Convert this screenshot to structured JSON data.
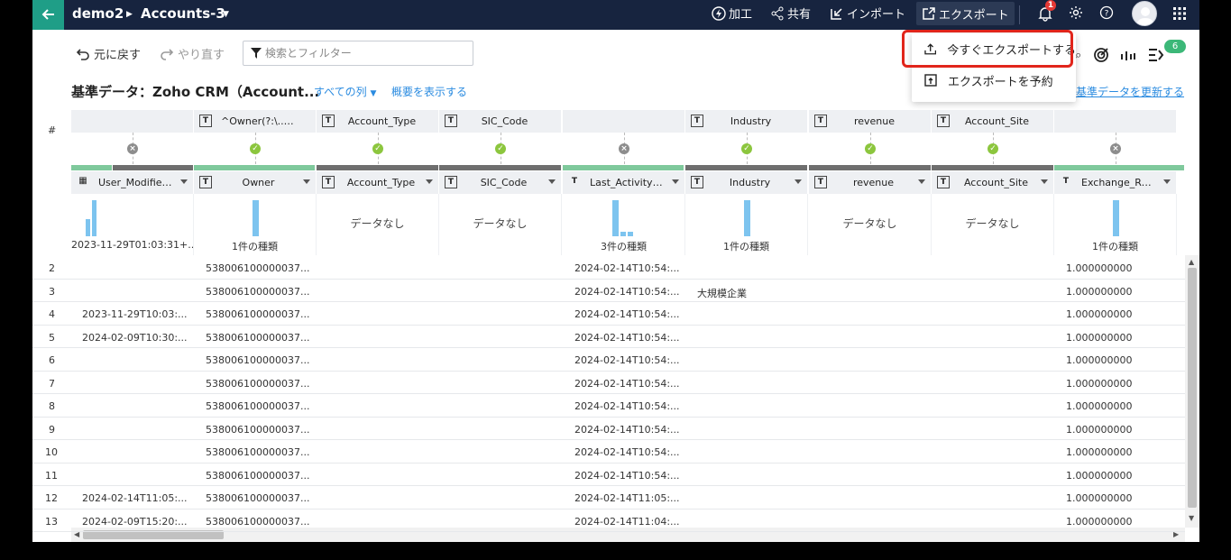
{
  "app": {
    "workspace": "demo2",
    "dataset": "Accounts-3"
  },
  "nav": {
    "process": "加工",
    "share": "共有",
    "import": "インポート",
    "export": "エクスポート",
    "notification_count": "1"
  },
  "toolbar": {
    "undo": "元に戻す",
    "redo": "やり直す",
    "search_placeholder": "検索とフィルター",
    "rules_count": "6"
  },
  "title_row": {
    "title": "基準データ：Zoho CRM（Account...",
    "all_columns": "すべての列",
    "show_summary": "概要を表示する",
    "refresh": "基準データを更新する"
  },
  "export_menu": {
    "export_now": "今すぐエクスポートする",
    "schedule_export": "エクスポートを予約"
  },
  "table": {
    "row_number_header": "#",
    "colors": {
      "valid": "#7fc99c",
      "invalid": "#6e6e6e",
      "ok_dot": "#8cc63e",
      "no_dot": "#8d8d8d",
      "accent": "#2a8be0",
      "highlight": "#e1251b"
    },
    "reference_columns": [
      {
        "name": "",
        "type": "",
        "status": "none"
      },
      {
        "name": "^Owner(?:\\..+)?$",
        "type": "T",
        "status": "ok"
      },
      {
        "name": "Account_Type",
        "type": "T",
        "status": "ok"
      },
      {
        "name": "SIC_Code",
        "type": "T",
        "status": "ok"
      },
      {
        "name": "",
        "type": "",
        "status": "none"
      },
      {
        "name": "Industry",
        "type": "T",
        "status": "ok"
      },
      {
        "name": "revenue",
        "type": "T",
        "status": "ok"
      },
      {
        "name": "Account_Site",
        "type": "T",
        "status": "ok"
      },
      {
        "name": "",
        "type": "",
        "status": "none"
      }
    ],
    "columns": [
      {
        "name": "User_Modified_Ti...",
        "type": "cal",
        "profile": "2023-11-29T01:03:31+..."
      },
      {
        "name": "Owner",
        "type": "T",
        "profile": "1件の種類"
      },
      {
        "name": "Account_Type",
        "type": "T",
        "profile": "データなし"
      },
      {
        "name": "SIC_Code",
        "type": "T",
        "profile": "データなし"
      },
      {
        "name": "Last_Activity_Time",
        "type": "T",
        "profile": "3件の種類"
      },
      {
        "name": "Industry",
        "type": "T",
        "profile": "1件の種類"
      },
      {
        "name": "revenue",
        "type": "T",
        "profile": "データなし"
      },
      {
        "name": "Account_Site",
        "type": "T",
        "profile": "データなし"
      },
      {
        "name": "Exchange_Rate",
        "type": "T",
        "profile": "1件の種類"
      }
    ],
    "rows": [
      {
        "n": "2",
        "modified": "",
        "owner": "538006100000037...",
        "last": "2024-02-14T10:54:...",
        "industry": "",
        "rate": "1.000000000"
      },
      {
        "n": "3",
        "modified": "",
        "owner": "538006100000037...",
        "last": "2024-02-14T10:54:...",
        "industry": "大規模企業",
        "rate": "1.000000000"
      },
      {
        "n": "4",
        "modified": "2023-11-29T10:03:...",
        "owner": "538006100000037...",
        "last": "2024-02-14T10:54:...",
        "industry": "",
        "rate": "1.000000000"
      },
      {
        "n": "5",
        "modified": "2024-02-09T10:30:...",
        "owner": "538006100000037...",
        "last": "2024-02-14T10:54:...",
        "industry": "",
        "rate": "1.000000000"
      },
      {
        "n": "6",
        "modified": "",
        "owner": "538006100000037...",
        "last": "2024-02-14T10:54:...",
        "industry": "",
        "rate": "1.000000000"
      },
      {
        "n": "7",
        "modified": "",
        "owner": "538006100000037...",
        "last": "2024-02-14T10:54:...",
        "industry": "",
        "rate": "1.000000000"
      },
      {
        "n": "8",
        "modified": "",
        "owner": "538006100000037...",
        "last": "2024-02-14T10:54:...",
        "industry": "",
        "rate": "1.000000000"
      },
      {
        "n": "9",
        "modified": "",
        "owner": "538006100000037...",
        "last": "2024-02-14T10:54:...",
        "industry": "",
        "rate": "1.000000000"
      },
      {
        "n": "10",
        "modified": "",
        "owner": "538006100000037...",
        "last": "2024-02-14T10:54:...",
        "industry": "",
        "rate": "1.000000000"
      },
      {
        "n": "11",
        "modified": "",
        "owner": "538006100000037...",
        "last": "2024-02-14T10:54:...",
        "industry": "",
        "rate": "1.000000000"
      },
      {
        "n": "12",
        "modified": "2024-02-14T11:05:...",
        "owner": "538006100000037...",
        "last": "2024-02-14T11:05:...",
        "industry": "",
        "rate": "1.000000000"
      },
      {
        "n": "13",
        "modified": "2024-02-09T15:20:...",
        "owner": "538006100000037...",
        "last": "2024-02-14T11:04:...",
        "industry": "",
        "rate": "1.000000000"
      }
    ]
  }
}
